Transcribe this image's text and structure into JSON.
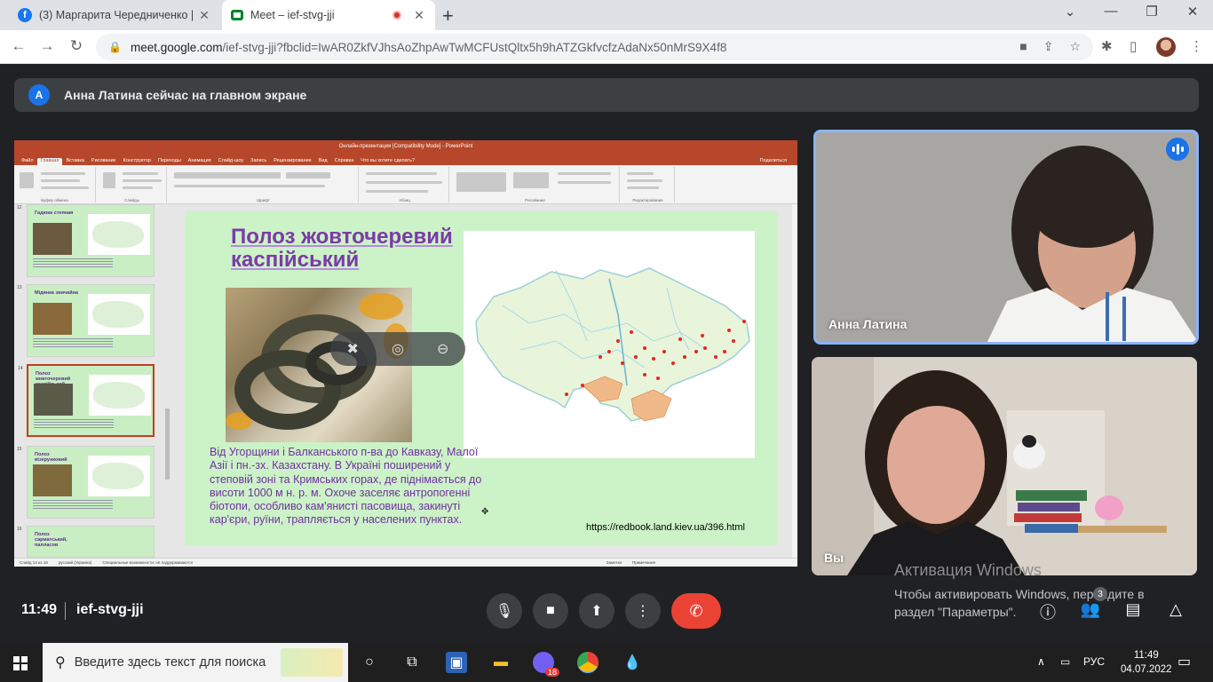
{
  "browser": {
    "tabs": [
      {
        "title": "(3) Маргарита Чередниченко | F",
        "favicon": "facebook-icon"
      },
      {
        "title": "Meet – ief-stvg-jji",
        "favicon": "google-meet-icon"
      }
    ],
    "url_host": "meet.google.com",
    "url_rest": "/ief-stvg-jji?fbclid=IwAR0ZkfVJhsAoZhpAwTwMCFUstQltx5h9hATZGkfvcfzAdaNx50nMrS9X4f8"
  },
  "meet": {
    "banner": {
      "avatar_letter": "A",
      "text": "Анна Латина сейчас на главном экране"
    },
    "participants": [
      {
        "name": "Анна Латина",
        "speaking": true
      },
      {
        "name": "Вы"
      }
    ],
    "time": "11:49",
    "meeting_code": "ief-stvg-jji",
    "participant_count": "3"
  },
  "powerpoint": {
    "window_title": "Онлайн-презентация [Compatibility Mode] - PowerPoint",
    "menu": [
      "Файл",
      "Главная",
      "Вставка",
      "Рисование",
      "Конструктор",
      "Переходы",
      "Анимация",
      "Слайд-шоу",
      "Запись",
      "Рецензирование",
      "Вид",
      "Справка",
      "Что вы хотите сделать?",
      "Поделиться"
    ],
    "ribbon_groups": [
      "Буфер обмена",
      "Слайды",
      "Шрифт",
      "Абзац",
      "Рисование",
      "Редактирование"
    ],
    "thumbnails": [
      {
        "num": "12",
        "title": "Гадюка степная"
      },
      {
        "num": "13",
        "title": "Мідянка звичайна"
      },
      {
        "num": "14",
        "title": "Полоз жовточеревий каспійський"
      },
      {
        "num": "15",
        "title": "Полоз візерунковий"
      },
      {
        "num": "16",
        "title": "Полоз сарматський, палласов"
      }
    ],
    "status": [
      "Слайд 14 из 16",
      "русский (Украина)",
      "Специальные возможности: не поддерживаются",
      "Заметки",
      "Примечания"
    ]
  },
  "slide": {
    "title": "Полоз жовточеревий каспійський",
    "body": "Від Угорщини і Балканського п-ва до Кавказу, Малої Азії і пн.-зх. Казахстану. В Україні поширений у степовій зоні та Кримських горах, де піднімається до висоти 1000 м н. р. м. Охоче заселяє антропогенні біотопи, особливо кам'янисті пасовища, закинуті кар'єри, руїни, трапляється у населених пунктах.",
    "link": "https://redbook.land.kiev.ua/396.html"
  },
  "activation": {
    "title": "Активация Windows",
    "text": "Чтобы активировать Windows, перейдите в раздел \"Параметры\"."
  },
  "taskbar": {
    "search_placeholder": "Введите здесь текст для поиска",
    "lang": "РУС",
    "time": "11:49",
    "date": "04.07.2022",
    "viber_badge": "18"
  }
}
